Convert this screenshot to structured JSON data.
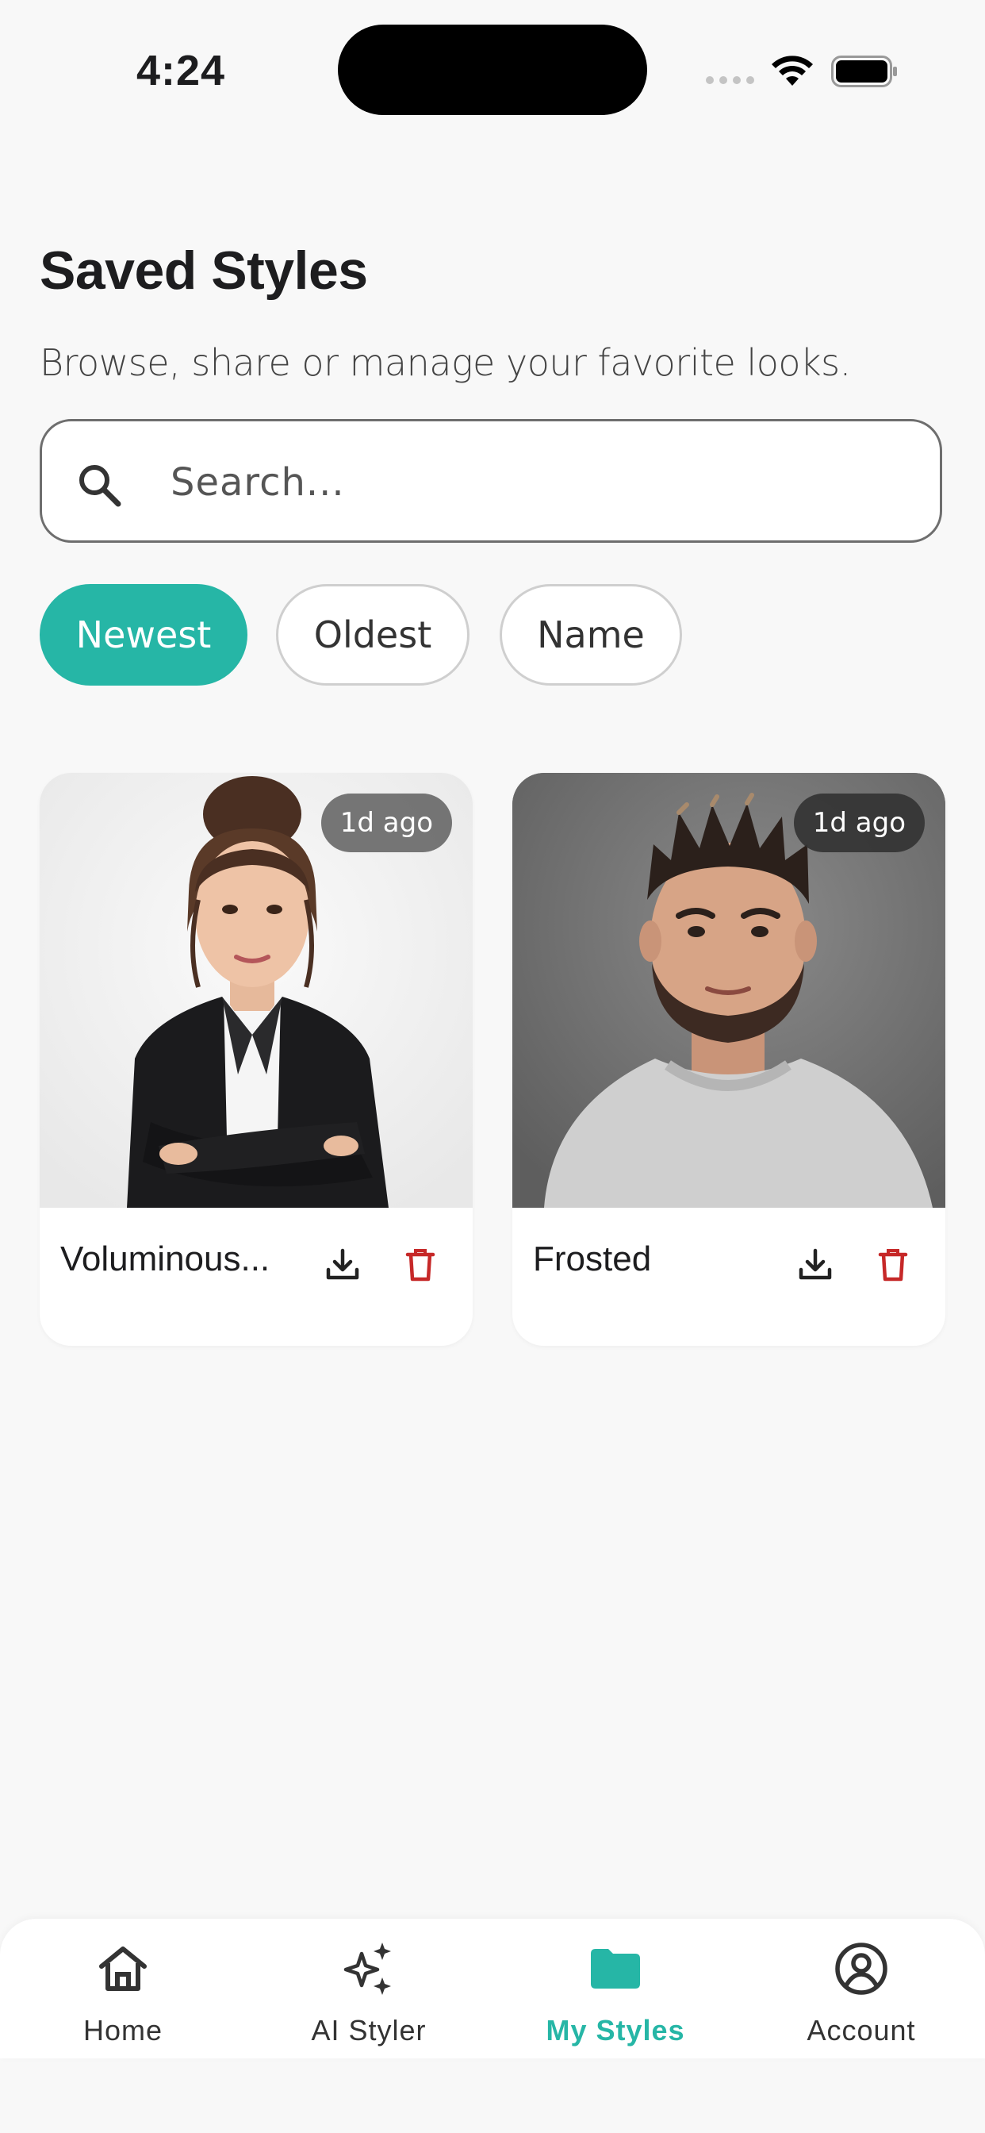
{
  "status_bar": {
    "time": "4:24"
  },
  "header": {
    "title": "Saved Styles",
    "subtitle": "Browse, share or manage your favorite looks."
  },
  "search": {
    "placeholder": "Search...",
    "value": ""
  },
  "filters": {
    "items": [
      {
        "label": "Newest",
        "active": true
      },
      {
        "label": "Oldest",
        "active": false
      },
      {
        "label": "Name",
        "active": false
      }
    ]
  },
  "styles": [
    {
      "name": "Voluminous...",
      "time_ago": "1d ago",
      "download_icon": "download-icon",
      "delete_icon": "trash-icon"
    },
    {
      "name": "Frosted",
      "time_ago": "1d ago",
      "download_icon": "download-icon",
      "delete_icon": "trash-icon"
    }
  ],
  "bottom_nav": {
    "items": [
      {
        "label": "Home",
        "icon": "home-icon",
        "active": false
      },
      {
        "label": "AI Styler",
        "icon": "sparkles-icon",
        "active": false
      },
      {
        "label": "My Styles",
        "icon": "folder-icon",
        "active": true
      },
      {
        "label": "Account",
        "icon": "account-icon",
        "active": false
      }
    ]
  },
  "colors": {
    "accent": "#26b6a6",
    "delete": "#c62828",
    "background": "#f8f8f8"
  }
}
